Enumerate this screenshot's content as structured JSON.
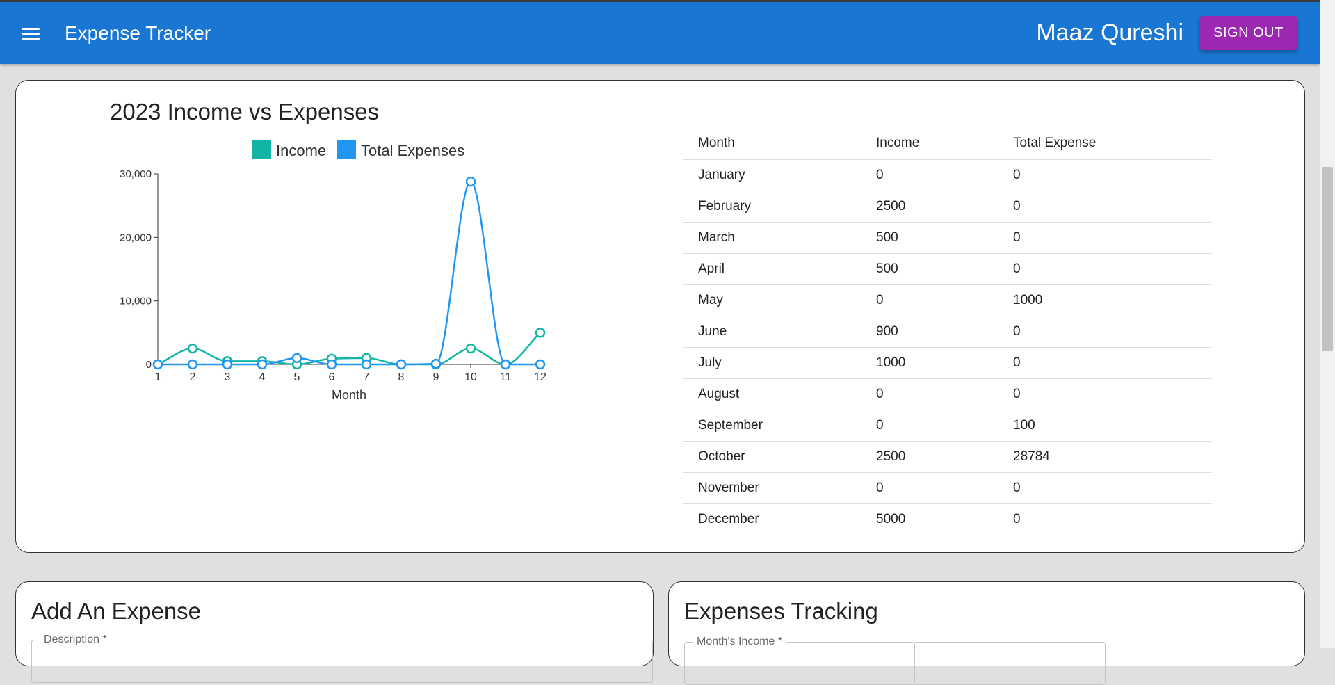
{
  "header": {
    "app_title": "Expense Tracker",
    "user_name": "Maaz Qureshi",
    "sign_out_label": "SIGN OUT",
    "menu_icon": "hamburger-menu-icon"
  },
  "summary": {
    "chart_title": "2023 Income vs Expenses",
    "table": {
      "headers": [
        "Month",
        "Income",
        "Total Expense"
      ],
      "rows": [
        [
          "January",
          "0",
          "0"
        ],
        [
          "February",
          "2500",
          "0"
        ],
        [
          "March",
          "500",
          "0"
        ],
        [
          "April",
          "500",
          "0"
        ],
        [
          "May",
          "0",
          "1000"
        ],
        [
          "June",
          "900",
          "0"
        ],
        [
          "July",
          "1000",
          "0"
        ],
        [
          "August",
          "0",
          "0"
        ],
        [
          "September",
          "0",
          "100"
        ],
        [
          "October",
          "2500",
          "28784"
        ],
        [
          "November",
          "0",
          "0"
        ],
        [
          "December",
          "5000",
          "0"
        ]
      ]
    }
  },
  "chart_data": {
    "type": "line",
    "title": "2023 Income vs Expenses",
    "xlabel": "Month",
    "ylabel": "",
    "x": [
      1,
      2,
      3,
      4,
      5,
      6,
      7,
      8,
      9,
      10,
      11,
      12
    ],
    "ylim": [
      0,
      30000
    ],
    "yticks": [
      0,
      10000,
      20000,
      30000
    ],
    "ytick_labels": [
      "0",
      "10,000",
      "20,000",
      "30,000"
    ],
    "legend_position": "top-center",
    "grid": false,
    "series": [
      {
        "name": "Income",
        "color": "#12b5a5",
        "values": [
          0,
          2500,
          500,
          500,
          0,
          900,
          1000,
          0,
          0,
          2500,
          0,
          5000
        ]
      },
      {
        "name": "Total Expenses",
        "color": "#2196f3",
        "values": [
          0,
          0,
          0,
          0,
          1000,
          0,
          0,
          0,
          100,
          28784,
          0,
          0
        ]
      }
    ]
  },
  "add_expense": {
    "heading": "Add An Expense",
    "description_label": "Description *"
  },
  "tracking": {
    "heading": "Expenses Tracking",
    "income_label": "Month's Income *"
  },
  "colors": {
    "appbar": "#1976d2",
    "sign_out_button": "#9c27b0",
    "income": "#12b5a5",
    "expenses": "#2196f3"
  }
}
